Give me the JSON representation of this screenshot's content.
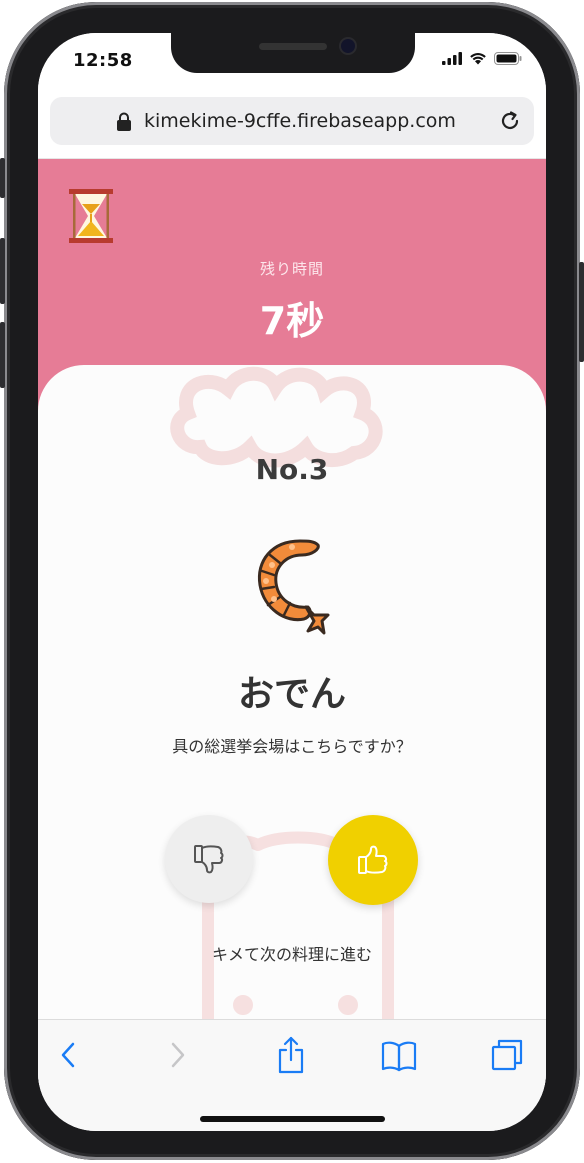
{
  "status_bar": {
    "time": "12:58",
    "icons": [
      "cellular-signal-icon",
      "wifi-icon",
      "battery-icon"
    ]
  },
  "browser": {
    "url": "kimekime-9cffe.firebaseapp.com",
    "icons": [
      "lock-icon",
      "reload-icon"
    ]
  },
  "timer": {
    "label": "残り時間",
    "value": "7秒",
    "icon": "hourglass-icon"
  },
  "item": {
    "number": "No.3",
    "name": "おでん",
    "question": "具の総選挙会場はこちらですか？",
    "icon": "shrimp-tempura-icon"
  },
  "actions": {
    "dislike_icon": "thumbs-down-icon",
    "like_icon": "thumbs-up-icon",
    "next_label": "キメて次の料理に進む"
  },
  "toolbar": {
    "items": [
      "back-icon",
      "forward-icon",
      "share-icon",
      "bookmarks-icon",
      "tabs-icon"
    ]
  },
  "colors": {
    "header": "#e67c96",
    "like_button": "#f0d000",
    "dislike_button": "#eeeeee",
    "ios_blue": "#1a7cf5"
  }
}
